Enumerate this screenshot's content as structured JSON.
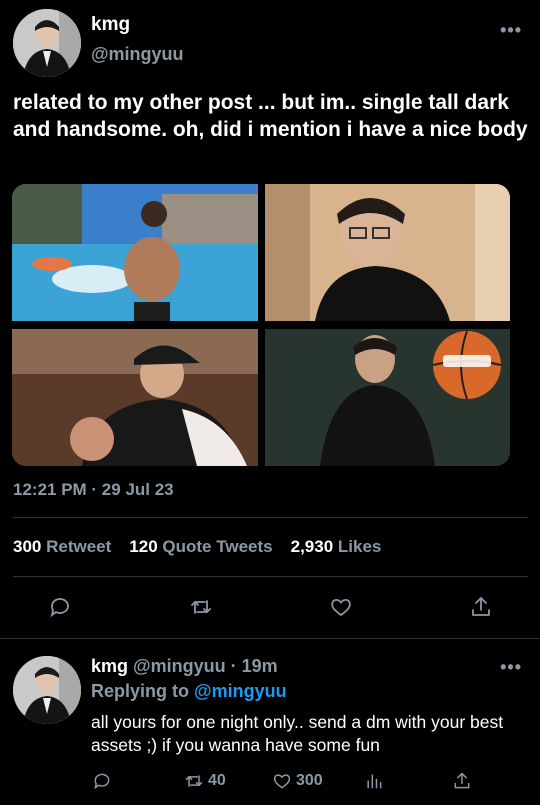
{
  "main_tweet": {
    "display_name": "kmg",
    "handle": "@mingyuu",
    "more": "•••",
    "text": "related to my other post ... but im.. single tall dark and handsome. oh, did i mention i have a nice body",
    "timestamp": "12:21 PM · 29 Jul 23",
    "stats": {
      "retweets_count": "300",
      "retweets_label": "Retweet",
      "quotes_count": "120",
      "quotes_label": "Quote Tweets",
      "likes_count": "2,930",
      "likes_label": "Likes"
    },
    "actions": [
      "reply-icon",
      "retweet-icon",
      "like-icon",
      "share-icon"
    ]
  },
  "reply_tweet": {
    "display_name": "kmg",
    "handle": "@mingyuu",
    "time": "19m",
    "more": "•••",
    "replying_prefix": "Replying to",
    "replying_to": "@mingyuu",
    "text": "all yours for one night only.. send a dm with your best assets ;) if you wanna have some fun",
    "retweet_count": "40",
    "like_count": "300"
  },
  "colors": {
    "background": "#000000",
    "text": "#e7e9ea",
    "secondary": "#8b98a5",
    "accent": "#1d9bf0",
    "divider": "#2f3336"
  }
}
